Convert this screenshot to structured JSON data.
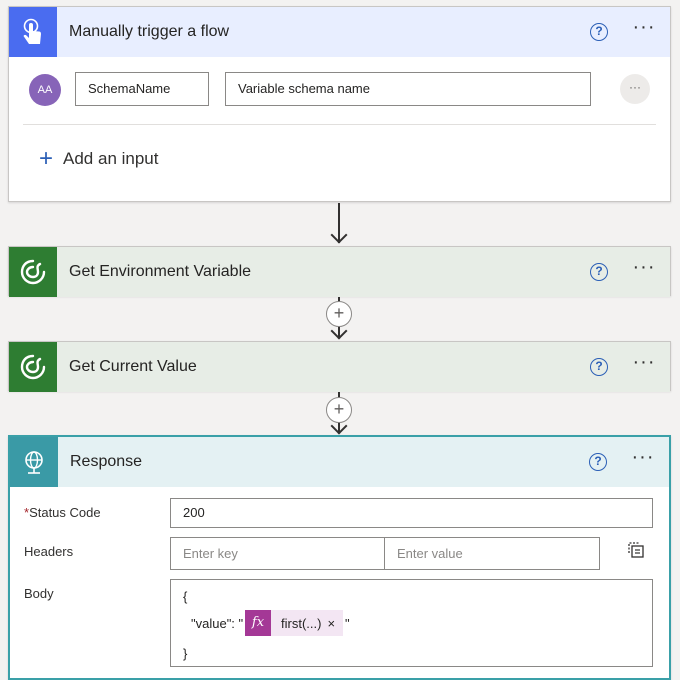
{
  "trigger": {
    "title": "Manually trigger a flow",
    "input": {
      "avatar": "AA",
      "name": "SchemaName",
      "value": "Variable schema name",
      "more": "···"
    },
    "add_input_label": "Add an input"
  },
  "env_card": {
    "title": "Get Environment Variable"
  },
  "current_card": {
    "title": "Get Current Value"
  },
  "response": {
    "title": "Response",
    "status_code_label": "Status Code",
    "status_code_value": "200",
    "headers_label": "Headers",
    "header_key_placeholder": "Enter key",
    "header_value_placeholder": "Enter value",
    "body_label": "Body",
    "body_open": "{",
    "body_key": "\"value\": \"",
    "body_quote_close": "\"",
    "body_close": "}",
    "token_fx": "fx",
    "token_label": "first(...)",
    "token_remove": "×"
  },
  "common": {
    "help": "?",
    "more": "···",
    "add_step": "+",
    "required_mark": "*"
  },
  "colors": {
    "trigger_accent": "#4a6cf0",
    "dataverse_accent": "#2e7d32",
    "response_accent": "#3a9aa6",
    "expression_token": "#a43896",
    "help_blue": "#2b5fb6"
  }
}
